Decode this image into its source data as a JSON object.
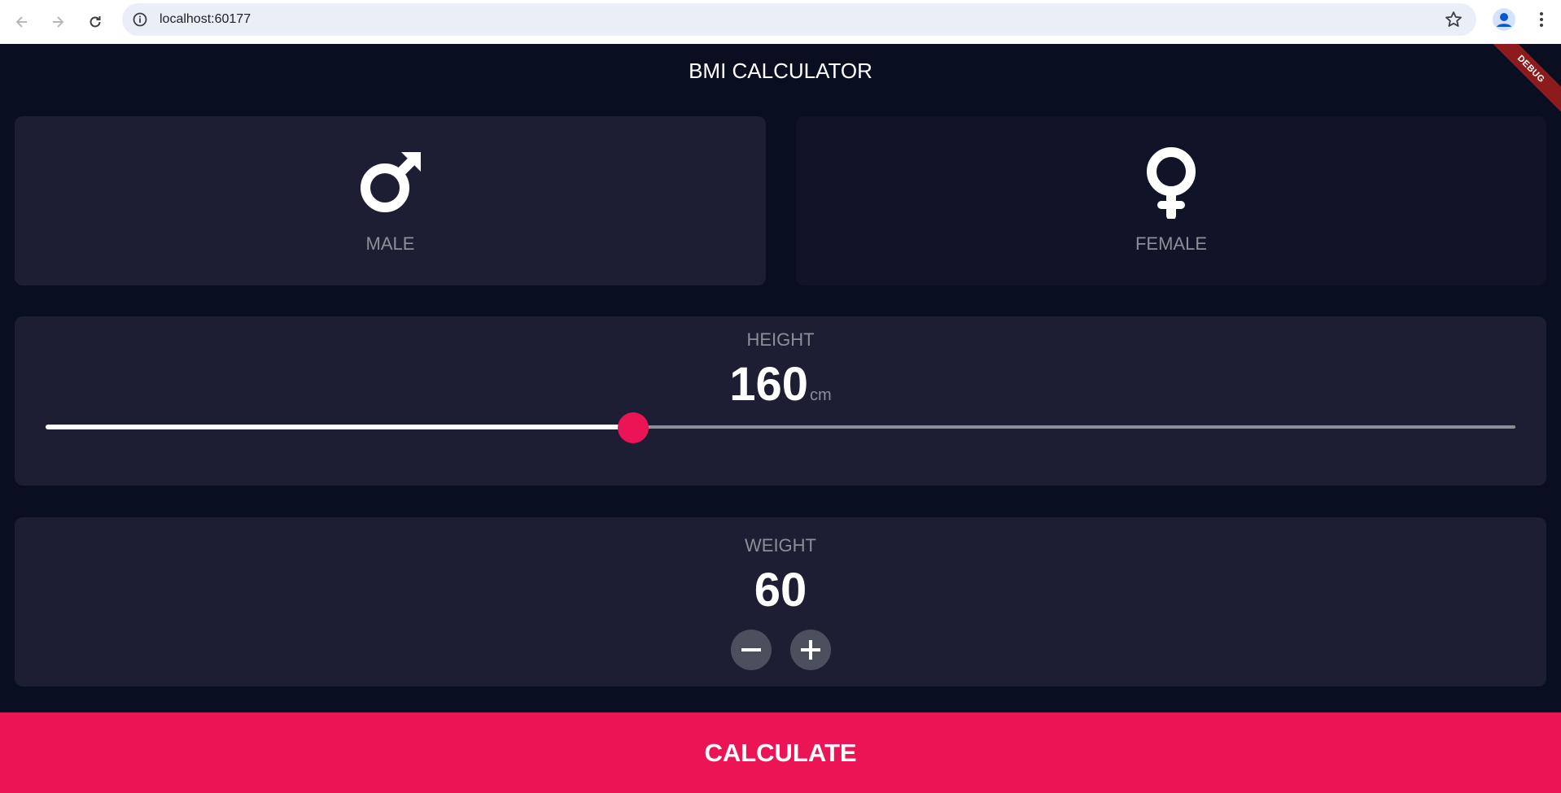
{
  "browser": {
    "url": "localhost:60177",
    "icons": {
      "back": "arrow-left-icon",
      "forward": "arrow-right-icon",
      "reload": "reload-icon",
      "info": "info-icon",
      "star": "star-icon",
      "profile": "profile-icon",
      "menu": "kebab-menu-icon"
    }
  },
  "app": {
    "title": "BMI CALCULATOR",
    "debug_banner": "DEBUG",
    "colors": {
      "background": "#0a0e21",
      "active_card": "#1d1e33",
      "inactive_card": "#111328",
      "accent": "#eb1555",
      "label": "#8d8e98",
      "round_button": "#4c4f5e"
    },
    "gender": {
      "male": {
        "label": "MALE",
        "icon": "male-symbol-icon",
        "selected": true
      },
      "female": {
        "label": "FEMALE",
        "icon": "female-symbol-icon",
        "selected": false
      }
    },
    "height": {
      "label": "HEIGHT",
      "value": "160",
      "unit": "cm",
      "slider_fraction": 0.4
    },
    "weight": {
      "label": "WEIGHT",
      "value": "60",
      "minus_icon": "minus-icon",
      "plus_icon": "plus-icon"
    },
    "calculate_label": "CALCULATE"
  }
}
